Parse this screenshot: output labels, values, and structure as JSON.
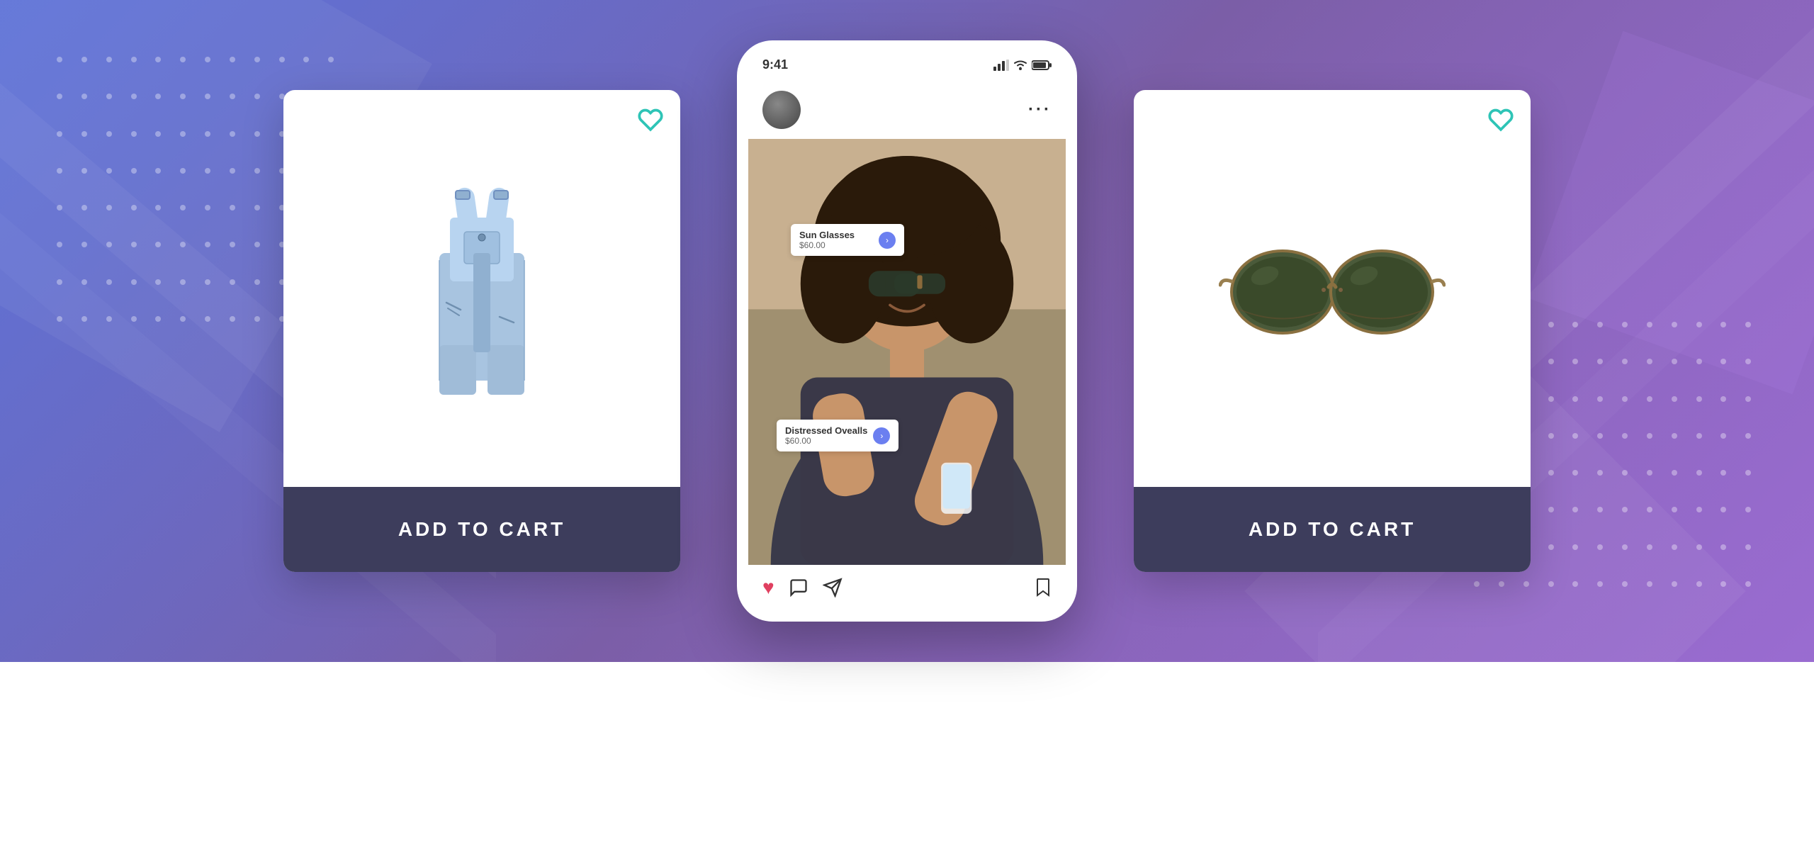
{
  "background": {
    "gradient_start": "#5b6fd4",
    "gradient_end": "#9b6fd4"
  },
  "left_card": {
    "product_name": "Distressed Overalls",
    "heart_color": "#2ec4b6",
    "add_to_cart_label": "ADD TO CART",
    "btn_bg": "#3d3d5c"
  },
  "right_card": {
    "product_name": "Sun Glasses",
    "heart_color": "#2ec4b6",
    "add_to_cart_label": "ADD TO CART",
    "btn_bg": "#3d3d5c"
  },
  "phone": {
    "time": "9:41",
    "tag1": {
      "name": "Sun Glasses",
      "price": "$60.00"
    },
    "tag2": {
      "name": "Distressed Ovealls",
      "price": "$60.00"
    }
  },
  "dots": {
    "color": "rgba(255,255,255,0.35)"
  }
}
